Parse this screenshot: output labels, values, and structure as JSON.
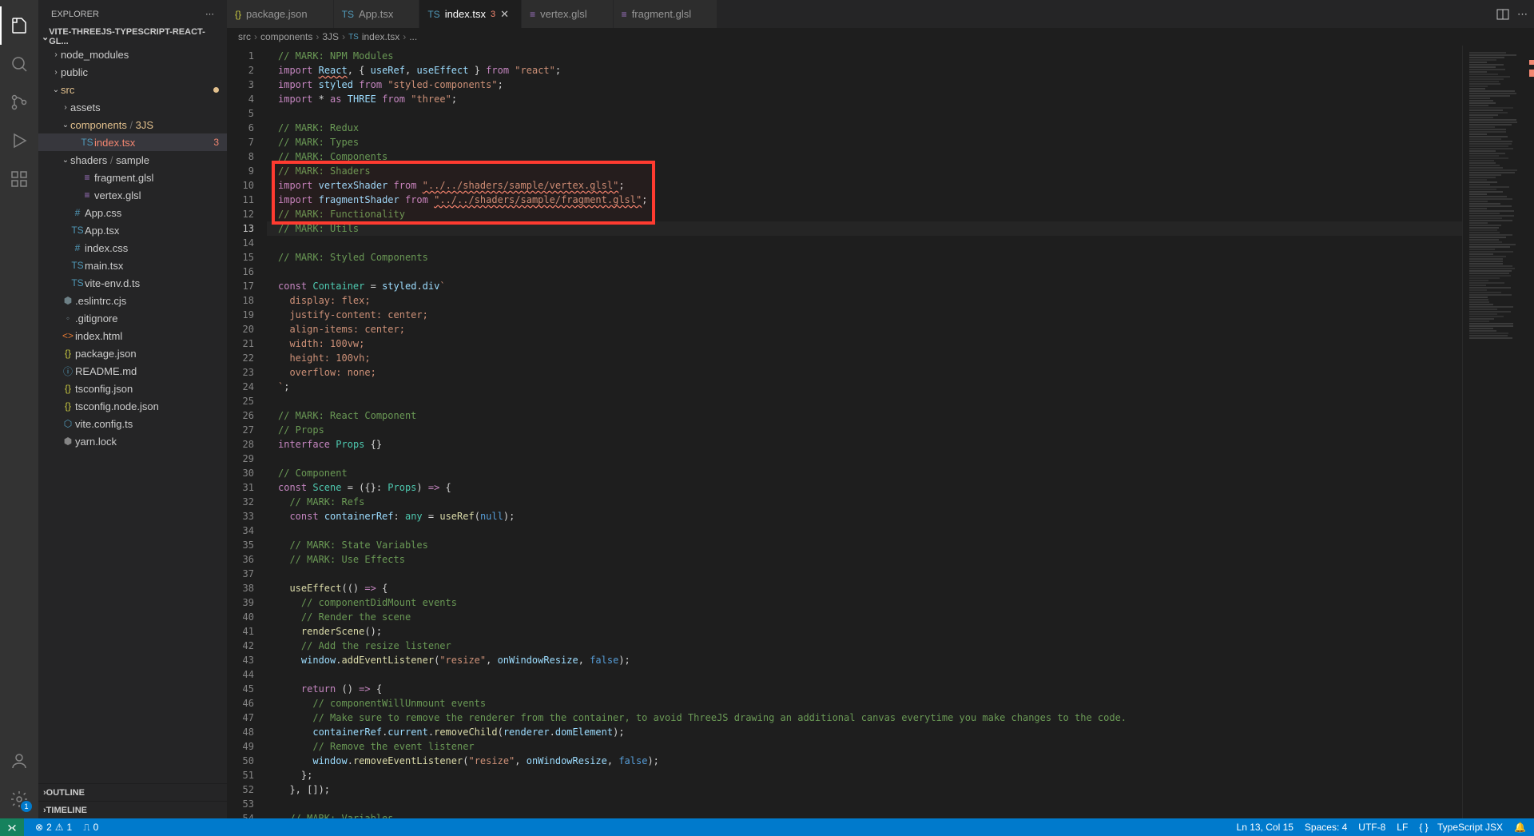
{
  "sidebar": {
    "header": "EXPLORER",
    "project": "VITE-THREEJS-TYPESCRIPT-REACT-GL...",
    "outline": "OUTLINE",
    "timeline": "TIMELINE"
  },
  "tree": [
    {
      "depth": 1,
      "chev": "›",
      "icon": "",
      "cls": "",
      "label": "node_modules"
    },
    {
      "depth": 1,
      "chev": "›",
      "icon": "",
      "cls": "",
      "label": "public"
    },
    {
      "depth": 1,
      "chev": "⌄",
      "icon": "",
      "cls": "dirt",
      "label": "src",
      "dot": true
    },
    {
      "depth": 2,
      "chev": "›",
      "icon": "",
      "cls": "",
      "label": "assets"
    },
    {
      "depth": 2,
      "chev": "⌄",
      "icon": "",
      "cls": "dirt",
      "label": "",
      "html": "<span class='dirt'>components</span><span style='color:#6e6e6e'> / </span><span class='dirt'>3JS</span>"
    },
    {
      "depth": 3,
      "chev": "",
      "icon": "TS",
      "cls": "fi-ts",
      "label": "index.tsx",
      "active": true,
      "err": "3"
    },
    {
      "depth": 2,
      "chev": "⌄",
      "icon": "",
      "cls": "",
      "label": "",
      "html": "<span>shaders</span><span style='color:#6e6e6e'> / </span><span>sample</span>"
    },
    {
      "depth": 3,
      "chev": "",
      "icon": "≡",
      "cls": "fi-glsl",
      "label": "fragment.glsl"
    },
    {
      "depth": 3,
      "chev": "",
      "icon": "≡",
      "cls": "fi-glsl",
      "label": "vertex.glsl"
    },
    {
      "depth": 2,
      "chev": "",
      "icon": "#",
      "cls": "fi-css",
      "label": "App.css"
    },
    {
      "depth": 2,
      "chev": "",
      "icon": "TS",
      "cls": "fi-ts",
      "label": "App.tsx"
    },
    {
      "depth": 2,
      "chev": "",
      "icon": "#",
      "cls": "fi-css",
      "label": "index.css"
    },
    {
      "depth": 2,
      "chev": "",
      "icon": "TS",
      "cls": "fi-ts",
      "label": "main.tsx"
    },
    {
      "depth": 2,
      "chev": "",
      "icon": "TS",
      "cls": "fi-ts",
      "label": "vite-env.d.ts"
    },
    {
      "depth": 1,
      "chev": "",
      "icon": "⬢",
      "cls": "fi-cfg",
      "label": ".eslintrc.cjs"
    },
    {
      "depth": 1,
      "chev": "",
      "icon": "◦",
      "cls": "fi-cfg",
      "label": ".gitignore"
    },
    {
      "depth": 1,
      "chev": "",
      "icon": "<>",
      "cls": "fi-html",
      "label": "index.html"
    },
    {
      "depth": 1,
      "chev": "",
      "icon": "{}",
      "cls": "fi-json",
      "label": "package.json"
    },
    {
      "depth": 1,
      "chev": "",
      "icon": "ⓘ",
      "cls": "fi-md",
      "label": "README.md"
    },
    {
      "depth": 1,
      "chev": "",
      "icon": "{}",
      "cls": "fi-json",
      "label": "tsconfig.json"
    },
    {
      "depth": 1,
      "chev": "",
      "icon": "{}",
      "cls": "fi-json",
      "label": "tsconfig.node.json"
    },
    {
      "depth": 1,
      "chev": "",
      "icon": "⬡",
      "cls": "fi-ts",
      "label": "vite.config.ts"
    },
    {
      "depth": 1,
      "chev": "",
      "icon": "⬢",
      "cls": "fi-lock",
      "label": "yarn.lock"
    }
  ],
  "tabs": [
    {
      "icon": "{}",
      "cls": "fi-json",
      "label": "package.json"
    },
    {
      "icon": "TS",
      "cls": "fi-ts",
      "label": "App.tsx"
    },
    {
      "icon": "TS",
      "cls": "fi-ts",
      "label": "index.tsx",
      "active": true,
      "err": "3"
    },
    {
      "icon": "≡",
      "cls": "fi-glsl",
      "label": "vertex.glsl"
    },
    {
      "icon": "≡",
      "cls": "fi-glsl",
      "label": "fragment.glsl"
    }
  ],
  "breadcrumb": [
    "src",
    "components",
    "3JS",
    "index.tsx",
    "..."
  ],
  "breadcrumb_icon_idx": 3,
  "code": [
    [
      [
        "c-comment",
        "// MARK: NPM Modules"
      ]
    ],
    [
      [
        "c-key",
        "import"
      ],
      [
        "c-plain",
        " "
      ],
      [
        "c-var err-underline",
        "React"
      ],
      [
        "c-plain",
        ", { "
      ],
      [
        "c-var",
        "useRef"
      ],
      [
        "c-plain",
        ", "
      ],
      [
        "c-var",
        "useEffect"
      ],
      [
        "c-plain",
        " } "
      ],
      [
        "c-key",
        "from"
      ],
      [
        "c-plain",
        " "
      ],
      [
        "c-str",
        "\"react\""
      ],
      [
        "c-plain",
        ";"
      ]
    ],
    [
      [
        "c-key",
        "import"
      ],
      [
        "c-plain",
        " "
      ],
      [
        "c-var",
        "styled"
      ],
      [
        "c-plain",
        " "
      ],
      [
        "c-key",
        "from"
      ],
      [
        "c-plain",
        " "
      ],
      [
        "c-str",
        "\"styled-components\""
      ],
      [
        "c-plain",
        ";"
      ]
    ],
    [
      [
        "c-key",
        "import"
      ],
      [
        "c-plain",
        " * "
      ],
      [
        "c-key",
        "as"
      ],
      [
        "c-plain",
        " "
      ],
      [
        "c-var",
        "THREE"
      ],
      [
        "c-plain",
        " "
      ],
      [
        "c-key",
        "from"
      ],
      [
        "c-plain",
        " "
      ],
      [
        "c-str",
        "\"three\""
      ],
      [
        "c-plain",
        ";"
      ]
    ],
    [],
    [
      [
        "c-comment",
        "// MARK: Redux"
      ]
    ],
    [
      [
        "c-comment",
        "// MARK: Types"
      ]
    ],
    [
      [
        "c-comment",
        "// MARK: Components"
      ]
    ],
    [
      [
        "c-comment",
        "// MARK: Shaders"
      ]
    ],
    [
      [
        "c-key",
        "import"
      ],
      [
        "c-plain",
        " "
      ],
      [
        "c-var",
        "vertexShader"
      ],
      [
        "c-plain",
        " "
      ],
      [
        "c-key",
        "from"
      ],
      [
        "c-plain",
        " "
      ],
      [
        "c-str err-underline",
        "\"../../shaders/sample/vertex.glsl\""
      ],
      [
        "c-plain",
        ";"
      ]
    ],
    [
      [
        "c-key",
        "import"
      ],
      [
        "c-plain",
        " "
      ],
      [
        "c-var",
        "fragmentShader"
      ],
      [
        "c-plain",
        " "
      ],
      [
        "c-key",
        "from"
      ],
      [
        "c-plain",
        " "
      ],
      [
        "c-str err-underline",
        "\"../../shaders/sample/fragment.glsl\""
      ],
      [
        "c-plain",
        ";"
      ]
    ],
    [
      [
        "c-comment",
        "// MARK: Functionality"
      ]
    ],
    [
      [
        "c-comment",
        "// MARK: Utils"
      ]
    ],
    [],
    [
      [
        "c-comment",
        "// MARK: Styled Components"
      ]
    ],
    [],
    [
      [
        "c-key",
        "const"
      ],
      [
        "c-plain",
        " "
      ],
      [
        "c-type",
        "Container"
      ],
      [
        "c-plain",
        " = "
      ],
      [
        "c-var",
        "styled"
      ],
      [
        "c-plain",
        "."
      ],
      [
        "c-var",
        "div"
      ],
      [
        "c-str",
        "`"
      ]
    ],
    [
      [
        "c-str",
        "  display: flex;"
      ]
    ],
    [
      [
        "c-str",
        "  justify-content: center;"
      ]
    ],
    [
      [
        "c-str",
        "  align-items: center;"
      ]
    ],
    [
      [
        "c-str",
        "  width: 100vw;"
      ]
    ],
    [
      [
        "c-str",
        "  height: 100vh;"
      ]
    ],
    [
      [
        "c-str",
        "  overflow: none;"
      ]
    ],
    [
      [
        "c-str",
        "`"
      ],
      [
        "c-plain",
        ";"
      ]
    ],
    [],
    [
      [
        "c-comment",
        "// MARK: React Component"
      ]
    ],
    [
      [
        "c-comment",
        "// Props"
      ]
    ],
    [
      [
        "c-key",
        "interface"
      ],
      [
        "c-plain",
        " "
      ],
      [
        "c-type",
        "Props"
      ],
      [
        "c-plain",
        " {}"
      ]
    ],
    [],
    [
      [
        "c-comment",
        "// Component"
      ]
    ],
    [
      [
        "c-key",
        "const"
      ],
      [
        "c-plain",
        " "
      ],
      [
        "c-type",
        "Scene"
      ],
      [
        "c-plain",
        " = ({}: "
      ],
      [
        "c-type",
        "Props"
      ],
      [
        "c-plain",
        ") "
      ],
      [
        "c-key",
        "=>"
      ],
      [
        "c-plain",
        " {"
      ]
    ],
    [
      [
        "c-plain",
        "  "
      ],
      [
        "c-comment",
        "// MARK: Refs"
      ]
    ],
    [
      [
        "c-plain",
        "  "
      ],
      [
        "c-key",
        "const"
      ],
      [
        "c-plain",
        " "
      ],
      [
        "c-var",
        "containerRef"
      ],
      [
        "c-plain",
        ": "
      ],
      [
        "c-type",
        "any"
      ],
      [
        "c-plain",
        " = "
      ],
      [
        "c-func",
        "useRef"
      ],
      [
        "c-plain",
        "("
      ],
      [
        "c-const",
        "null"
      ],
      [
        "c-plain",
        ");"
      ]
    ],
    [],
    [
      [
        "c-plain",
        "  "
      ],
      [
        "c-comment",
        "// MARK: State Variables"
      ]
    ],
    [
      [
        "c-plain",
        "  "
      ],
      [
        "c-comment",
        "// MARK: Use Effects"
      ]
    ],
    [],
    [
      [
        "c-plain",
        "  "
      ],
      [
        "c-func",
        "useEffect"
      ],
      [
        "c-plain",
        "(() "
      ],
      [
        "c-key",
        "=>"
      ],
      [
        "c-plain",
        " {"
      ]
    ],
    [
      [
        "c-plain",
        "    "
      ],
      [
        "c-comment",
        "// componentDidMount events"
      ]
    ],
    [
      [
        "c-plain",
        "    "
      ],
      [
        "c-comment",
        "// Render the scene"
      ]
    ],
    [
      [
        "c-plain",
        "    "
      ],
      [
        "c-func",
        "renderScene"
      ],
      [
        "c-plain",
        "();"
      ]
    ],
    [
      [
        "c-plain",
        "    "
      ],
      [
        "c-comment",
        "// Add the resize listener"
      ]
    ],
    [
      [
        "c-plain",
        "    "
      ],
      [
        "c-var",
        "window"
      ],
      [
        "c-plain",
        "."
      ],
      [
        "c-func",
        "addEventListener"
      ],
      [
        "c-plain",
        "("
      ],
      [
        "c-str",
        "\"resize\""
      ],
      [
        "c-plain",
        ", "
      ],
      [
        "c-var",
        "onWindowResize"
      ],
      [
        "c-plain",
        ", "
      ],
      [
        "c-const",
        "false"
      ],
      [
        "c-plain",
        ");"
      ]
    ],
    [],
    [
      [
        "c-plain",
        "    "
      ],
      [
        "c-key",
        "return"
      ],
      [
        "c-plain",
        " () "
      ],
      [
        "c-key",
        "=>"
      ],
      [
        "c-plain",
        " {"
      ]
    ],
    [
      [
        "c-plain",
        "      "
      ],
      [
        "c-comment",
        "// componentWillUnmount events"
      ]
    ],
    [
      [
        "c-plain",
        "      "
      ],
      [
        "c-comment",
        "// Make sure to remove the renderer from the container, to avoid ThreeJS drawing an additional canvas everytime you make changes to the code."
      ]
    ],
    [
      [
        "c-plain",
        "      "
      ],
      [
        "c-var",
        "containerRef"
      ],
      [
        "c-plain",
        "."
      ],
      [
        "c-var",
        "current"
      ],
      [
        "c-plain",
        "."
      ],
      [
        "c-func",
        "removeChild"
      ],
      [
        "c-plain",
        "("
      ],
      [
        "c-var",
        "renderer"
      ],
      [
        "c-plain",
        "."
      ],
      [
        "c-var",
        "domElement"
      ],
      [
        "c-plain",
        ");"
      ]
    ],
    [
      [
        "c-plain",
        "      "
      ],
      [
        "c-comment",
        "// Remove the event listener"
      ]
    ],
    [
      [
        "c-plain",
        "      "
      ],
      [
        "c-var",
        "window"
      ],
      [
        "c-plain",
        "."
      ],
      [
        "c-func",
        "removeEventListener"
      ],
      [
        "c-plain",
        "("
      ],
      [
        "c-str",
        "\"resize\""
      ],
      [
        "c-plain",
        ", "
      ],
      [
        "c-var",
        "onWindowResize"
      ],
      [
        "c-plain",
        ", "
      ],
      [
        "c-const",
        "false"
      ],
      [
        "c-plain",
        ");"
      ]
    ],
    [
      [
        "c-plain",
        "    };"
      ]
    ],
    [
      [
        "c-plain",
        "  }, []);"
      ]
    ],
    [],
    [
      [
        "c-plain",
        "  "
      ],
      [
        "c-comment",
        "// MARK: Variables"
      ]
    ]
  ],
  "highlight": {
    "startLine": 9,
    "endLine": 12
  },
  "cursorLine": 13,
  "status": {
    "errors": "2",
    "warnings": "1",
    "ports": "0",
    "ln": "Ln 13, Col 15",
    "spaces": "Spaces: 4",
    "encoding": "UTF-8",
    "eol": "LF",
    "lang": "TypeScript JSX"
  }
}
